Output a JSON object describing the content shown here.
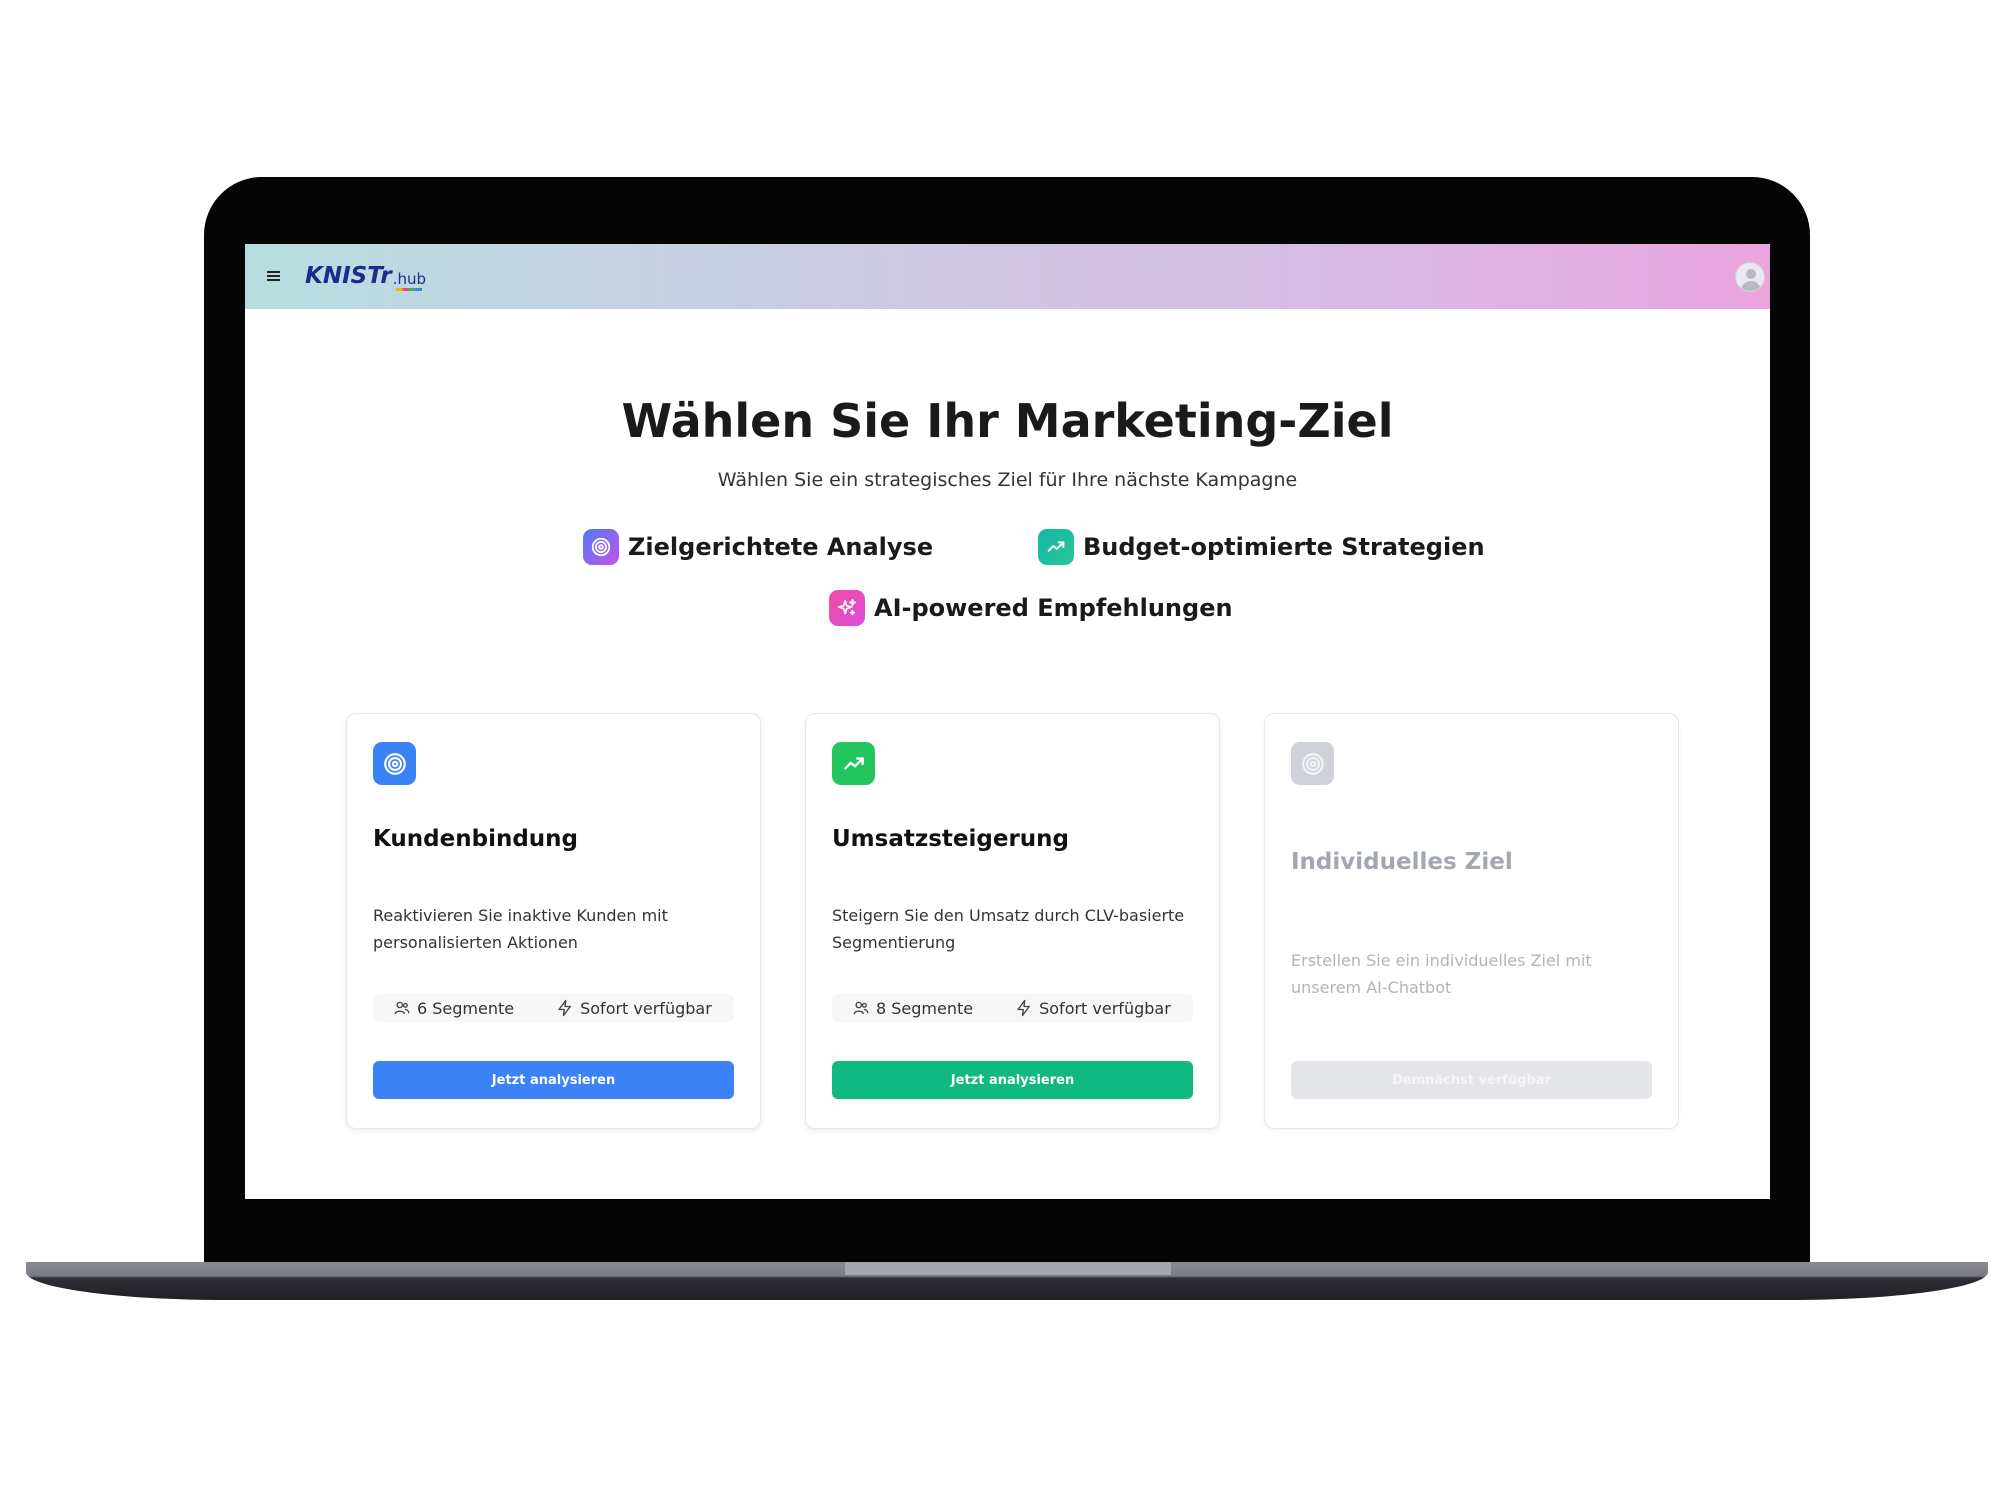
{
  "app": {
    "brand_main": "KNISTr",
    "brand_sub": ".hub",
    "colors": {
      "accent_blue": "#3b82f6",
      "accent_green": "#10b981",
      "brand": "#1f2a8c"
    }
  },
  "header": {
    "menu_icon": "hamburger-menu-icon",
    "avatar_icon": "user-avatar-icon"
  },
  "hero": {
    "title": "Wählen Sie Ihr Marketing-Ziel",
    "subtitle": "Wählen Sie ein strategisches Ziel für Ihre nächste Kampagne",
    "features": [
      {
        "label": "Zielgerichtete Analyse",
        "icon": "target-icon"
      },
      {
        "label": "Budget-optimierte Strategien",
        "icon": "trending-up-icon"
      },
      {
        "label": "AI-powered Empfehlungen",
        "icon": "sparkles-icon"
      }
    ]
  },
  "cards": [
    {
      "title": "Kundenbindung",
      "description": "Reaktivieren Sie inaktive Kunden mit personalisierten Aktionen",
      "segments": "6 Segmente",
      "availability": "Sofort verfügbar",
      "button": "Jetzt analysieren",
      "icon": "target-icon",
      "enabled": true
    },
    {
      "title": "Umsatzsteigerung",
      "description": "Steigern Sie den Umsatz durch CLV-basierte Segmentierung",
      "segments": "8 Segmente",
      "availability": "Sofort verfügbar",
      "button": "Jetzt analysieren",
      "icon": "trending-up-icon",
      "enabled": true
    },
    {
      "title": "Individuelles Ziel",
      "description": "Erstellen Sie ein individuelles Ziel mit unserem AI-Chatbot",
      "button": "Demnächst verfügbar",
      "icon": "target-icon",
      "enabled": false
    }
  ]
}
